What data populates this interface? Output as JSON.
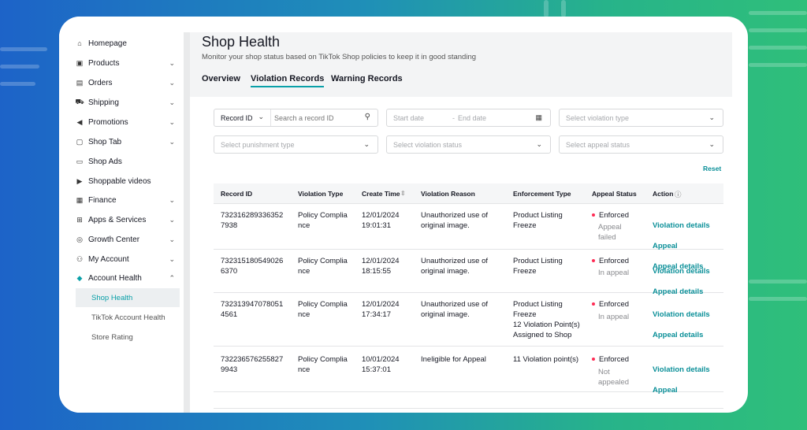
{
  "sidebar": {
    "items": [
      {
        "label": "Homepage",
        "icon": "home-icon",
        "chevron": ""
      },
      {
        "label": "Products",
        "icon": "box-icon",
        "chevron": "⌄"
      },
      {
        "label": "Orders",
        "icon": "clipboard-icon",
        "chevron": "⌄"
      },
      {
        "label": "Shipping",
        "icon": "truck-icon",
        "chevron": "⌄"
      },
      {
        "label": "Promotions",
        "icon": "megaphone-icon",
        "chevron": "⌄"
      },
      {
        "label": "Shop Tab",
        "icon": "shopping-bag-icon",
        "chevron": "⌄"
      },
      {
        "label": "Shop Ads",
        "icon": "ad-icon",
        "chevron": ""
      },
      {
        "label": "Shoppable videos",
        "icon": "video-icon",
        "chevron": ""
      },
      {
        "label": "Finance",
        "icon": "finance-icon",
        "chevron": "⌄"
      },
      {
        "label": "Apps & Services",
        "icon": "apps-icon",
        "chevron": "⌄"
      },
      {
        "label": "Growth Center",
        "icon": "growth-icon",
        "chevron": "⌄"
      },
      {
        "label": "My Account",
        "icon": "user-icon",
        "chevron": "⌄"
      },
      {
        "label": "Account Health",
        "icon": "diamond-icon",
        "chevron": "⌃"
      }
    ],
    "subitems": [
      {
        "label": "Shop Health"
      },
      {
        "label": "TikTok Account Health"
      },
      {
        "label": "Store Rating"
      }
    ]
  },
  "page": {
    "title": "Shop Health",
    "subtitle": "Monitor your shop status based on TikTok Shop policies to keep it in good standing"
  },
  "tabs": [
    {
      "label": "Overview"
    },
    {
      "label": "Violation Records"
    },
    {
      "label": "Warning Records"
    }
  ],
  "filters": {
    "record_select": "Record ID",
    "search_placeholder": "Search a record ID",
    "start_date": "Start date",
    "date_sep": "-",
    "end_date": "End date",
    "violation_type": "Select violation type",
    "punishment_type": "Select punishment type",
    "violation_status": "Select violation status",
    "appeal_status": "Select appeal status",
    "reset": "Reset"
  },
  "table": {
    "headers": [
      "Record ID",
      "Violation Type",
      "Create Time",
      "Violation Reason",
      "Enforcement Type",
      "Appeal Status",
      "Action"
    ],
    "rows": [
      {
        "record_id": "732316289336352\n7938",
        "type": "Policy Complia\nnce",
        "time": "12/01/2024\n19:01:31",
        "reason": "Unauthorized use of\noriginal image.",
        "enforcement": "Product Listing\nFreeze",
        "status": "Enforced",
        "appeal": "Appeal\nfailed",
        "actions": [
          "Violation details",
          "Appeal",
          "Appeal details"
        ]
      },
      {
        "record_id": "732315180549026\n6370",
        "type": "Policy Complia\nnce",
        "time": "12/01/2024\n18:15:55",
        "reason": "Unauthorized use of\noriginal image.",
        "enforcement": "Product Listing\nFreeze",
        "status": "Enforced",
        "appeal": "In appeal",
        "actions": [
          "Violation details",
          "Appeal details"
        ]
      },
      {
        "record_id": "732313947078051\n4561",
        "type": "Policy Complia\nnce",
        "time": "12/01/2024\n17:34:17",
        "reason": "Unauthorized use of\noriginal image.",
        "enforcement": "Product Listing\nFreeze\n12 Violation Point(s)\nAssigned to Shop",
        "status": "Enforced",
        "appeal": "In appeal",
        "actions": [
          "Violation details",
          "Appeal details"
        ]
      },
      {
        "record_id": "732236576255827\n9943",
        "type": "Policy Complia\nnce",
        "time": "10/01/2024\n15:37:01",
        "reason": "Ineligible for Appeal",
        "enforcement": "11 Violation point(s)",
        "status": "Enforced",
        "appeal": "Not\nappealed",
        "actions": [
          "Violation details",
          "Appeal"
        ]
      }
    ]
  }
}
